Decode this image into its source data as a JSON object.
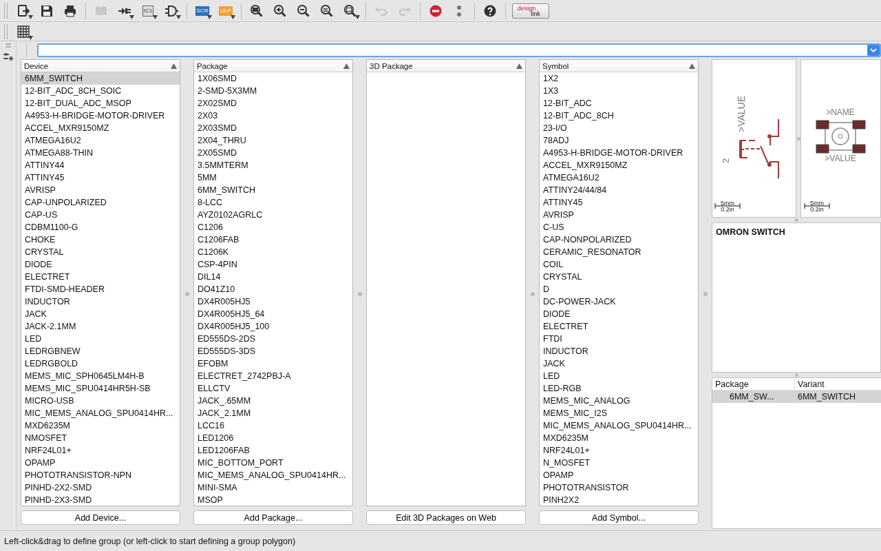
{
  "toolbar": [
    [
      {
        "kind": "open",
        "menu": true,
        "disabled": false
      },
      {
        "kind": "save",
        "menu": false,
        "disabled": false
      },
      {
        "kind": "print",
        "menu": false,
        "disabled": false
      }
    ],
    [
      {
        "kind": "library",
        "menu": false,
        "disabled": true
      },
      {
        "kind": "pins",
        "menu": true,
        "disabled": false
      },
      {
        "kind": "chip",
        "label": "IC1",
        "menu": true,
        "disabled": false
      },
      {
        "kind": "gate",
        "menu": true,
        "disabled": false
      }
    ],
    [
      {
        "kind": "script",
        "label": "SCR",
        "menu": true,
        "disabled": false
      },
      {
        "kind": "ulp",
        "label": "ULP",
        "menu": true,
        "disabled": false
      }
    ],
    [
      {
        "kind": "zoom-fit",
        "menu": false,
        "disabled": false
      },
      {
        "kind": "zoom-in",
        "menu": false,
        "disabled": false
      },
      {
        "kind": "zoom-out",
        "menu": false,
        "disabled": false
      },
      {
        "kind": "zoom-select",
        "menu": false,
        "disabled": false
      },
      {
        "kind": "zoom-area",
        "menu": true,
        "disabled": false
      }
    ],
    [
      {
        "kind": "undo",
        "menu": false,
        "disabled": true
      },
      {
        "kind": "redo",
        "menu": false,
        "disabled": true
      }
    ],
    [
      {
        "kind": "stop",
        "menu": false,
        "disabled": false
      },
      {
        "kind": "more",
        "menu": false,
        "disabled": false
      }
    ],
    [
      {
        "kind": "help",
        "menu": false,
        "disabled": false
      }
    ]
  ],
  "design_link": {
    "top": "design",
    "bottom": "link"
  },
  "columns": [
    {
      "title": "Device",
      "button": "Add Device...",
      "items": [
        {
          "name": "6MM_SWITCH",
          "selected": true
        },
        {
          "name": "12-BIT_ADC_8CH_SOIC",
          "selected": false
        },
        {
          "name": "12-BIT_DUAL_ADC_MSOP",
          "selected": false
        },
        {
          "name": "A4953-H-BRIDGE-MOTOR-DRIVER",
          "selected": false
        },
        {
          "name": "ACCEL_MXR9150MZ",
          "selected": false
        },
        {
          "name": "ATMEGA16U2",
          "selected": false
        },
        {
          "name": "ATMEGA88-THIN",
          "selected": false
        },
        {
          "name": "ATTINY44",
          "selected": false
        },
        {
          "name": "ATTINY45",
          "selected": false
        },
        {
          "name": "AVRISP",
          "selected": false
        },
        {
          "name": "CAP-UNPOLARIZED",
          "selected": false
        },
        {
          "name": "CAP-US",
          "selected": false
        },
        {
          "name": "CDBM1100-G",
          "selected": false
        },
        {
          "name": "CHOKE",
          "selected": false
        },
        {
          "name": "CRYSTAL",
          "selected": false
        },
        {
          "name": "DIODE",
          "selected": false
        },
        {
          "name": "ELECTRET",
          "selected": false
        },
        {
          "name": "FTDI-SMD-HEADER",
          "selected": false
        },
        {
          "name": "INDUCTOR",
          "selected": false
        },
        {
          "name": "JACK",
          "selected": false
        },
        {
          "name": "JACK-2.1MM",
          "selected": false
        },
        {
          "name": "LED",
          "selected": false
        },
        {
          "name": "LEDRGBNEW",
          "selected": false
        },
        {
          "name": "LEDRGBOLD",
          "selected": false
        },
        {
          "name": "MEMS_MIC_SPH0645LM4H-B",
          "selected": false
        },
        {
          "name": "MEMS_MIC_SPU0414HR5H-SB",
          "selected": false
        },
        {
          "name": "MICRO-USB",
          "selected": false
        },
        {
          "name": "MIC_MEMS_ANALOG_SPU0414HR...",
          "selected": false
        },
        {
          "name": "MXD6235M",
          "selected": false
        },
        {
          "name": "NMOSFET",
          "selected": false
        },
        {
          "name": "NRF24L01+",
          "selected": false
        },
        {
          "name": "OPAMP",
          "selected": false
        },
        {
          "name": "PHOTOTRANSISTOR-NPN",
          "selected": false
        },
        {
          "name": "PINHD-2X2-SMD",
          "selected": false
        },
        {
          "name": "PINHD-2X3-SMD",
          "selected": false
        }
      ]
    },
    {
      "title": "Package",
      "button": "Add Package...",
      "items": [
        {
          "name": "1X06SMD",
          "selected": false
        },
        {
          "name": "2-SMD-5X3MM",
          "selected": false
        },
        {
          "name": "2X02SMD",
          "selected": false
        },
        {
          "name": "2X03",
          "selected": false
        },
        {
          "name": "2X03SMD",
          "selected": false
        },
        {
          "name": "2X04_THRU",
          "selected": false
        },
        {
          "name": "2X05SMD",
          "selected": false
        },
        {
          "name": "3.5MMTERM",
          "selected": false
        },
        {
          "name": "5MM",
          "selected": false
        },
        {
          "name": "6MM_SWITCH",
          "selected": false
        },
        {
          "name": "8-LCC",
          "selected": false
        },
        {
          "name": "AYZ0102AGRLC",
          "selected": false
        },
        {
          "name": "C1206",
          "selected": false
        },
        {
          "name": "C1206FAB",
          "selected": false
        },
        {
          "name": "C1206K",
          "selected": false
        },
        {
          "name": "CSP-4PIN",
          "selected": false
        },
        {
          "name": "DIL14",
          "selected": false
        },
        {
          "name": "DO41Z10",
          "selected": false
        },
        {
          "name": "DX4R005HJ5",
          "selected": false
        },
        {
          "name": "DX4R005HJ5_64",
          "selected": false
        },
        {
          "name": "DX4R005HJ5_100",
          "selected": false
        },
        {
          "name": "ED555DS-2DS",
          "selected": false
        },
        {
          "name": "ED555DS-3DS",
          "selected": false
        },
        {
          "name": "EFOBM",
          "selected": false
        },
        {
          "name": "ELECTRET_2742PBJ-A",
          "selected": false
        },
        {
          "name": "ELLCTV",
          "selected": false
        },
        {
          "name": "JACK_.65MM",
          "selected": false
        },
        {
          "name": "JACK_2.1MM",
          "selected": false
        },
        {
          "name": "LCC16",
          "selected": false
        },
        {
          "name": "LED1206",
          "selected": false
        },
        {
          "name": "LED1206FAB",
          "selected": false
        },
        {
          "name": "MIC_BOTTOM_PORT",
          "selected": false
        },
        {
          "name": "MIC_MEMS_ANALOG_SPU0414HR...",
          "selected": false
        },
        {
          "name": "MINI-SMA",
          "selected": false
        },
        {
          "name": "MSOP",
          "selected": false
        }
      ]
    },
    {
      "title": "3D Package",
      "button": "Edit 3D Packages on Web"
    },
    {
      "title": "Symbol",
      "button": "Add Symbol...",
      "items": [
        {
          "name": "1X2",
          "selected": false
        },
        {
          "name": "1X3",
          "selected": false
        },
        {
          "name": "12-BIT_ADC",
          "selected": false
        },
        {
          "name": "12-BIT_ADC_8CH",
          "selected": false
        },
        {
          "name": "23-I/O",
          "selected": false
        },
        {
          "name": "78ADJ",
          "selected": false
        },
        {
          "name": "A4953-H-BRIDGE-MOTOR-DRIVER",
          "selected": false
        },
        {
          "name": "ACCEL_MXR9150MZ",
          "selected": false
        },
        {
          "name": "ATMEGA16U2",
          "selected": false
        },
        {
          "name": "ATTINY24/44/84",
          "selected": false
        },
        {
          "name": "ATTINY45",
          "selected": false
        },
        {
          "name": "AVRISP",
          "selected": false
        },
        {
          "name": "C-US",
          "selected": false
        },
        {
          "name": "CAP-NONPOLARIZED",
          "selected": false
        },
        {
          "name": "CERAMIC_RESONATOR",
          "selected": false
        },
        {
          "name": "COIL",
          "selected": false
        },
        {
          "name": "CRYSTAL",
          "selected": false
        },
        {
          "name": "D",
          "selected": false
        },
        {
          "name": "DC-POWER-JACK",
          "selected": false
        },
        {
          "name": "DIODE",
          "selected": false
        },
        {
          "name": "ELECTRET",
          "selected": false
        },
        {
          "name": "FTDI",
          "selected": false
        },
        {
          "name": "INDUCTOR",
          "selected": false
        },
        {
          "name": "JACK",
          "selected": false
        },
        {
          "name": "LED",
          "selected": false
        },
        {
          "name": "LED-RGB",
          "selected": false
        },
        {
          "name": "MEMS_MIC_ANALOG",
          "selected": false
        },
        {
          "name": "MEMS_MIC_I2S",
          "selected": false
        },
        {
          "name": "MIC_MEMS_ANALOG_SPU0414HR...",
          "selected": false
        },
        {
          "name": "MXD6235M",
          "selected": false
        },
        {
          "name": "NRF24L01+",
          "selected": false
        },
        {
          "name": "N_MOSFET",
          "selected": false
        },
        {
          "name": "OPAMP",
          "selected": false
        },
        {
          "name": "PHOTOTRANSISTOR",
          "selected": false
        },
        {
          "name": "PINH2X2",
          "selected": false
        }
      ]
    }
  ],
  "preview": {
    "symbol": {
      "value_label": ">VALUE",
      "gate": "2",
      "scale_mm": "5mm",
      "scale_in": "0.2in"
    },
    "package": {
      "name_label": ">NAME",
      "value_label": ">VALUE",
      "scale_mm": "5mm",
      "scale_in": "0.2in"
    }
  },
  "description": "OMRON SWITCH",
  "variants": {
    "columns": [
      "Package",
      "Variant"
    ],
    "rows": [
      {
        "package": "6MM_SW...",
        "variant": "6MM_SWITCH",
        "selected": true
      }
    ]
  },
  "status_bar": "Left-click&drag to define group (or left-click to start defining a group polygon)"
}
